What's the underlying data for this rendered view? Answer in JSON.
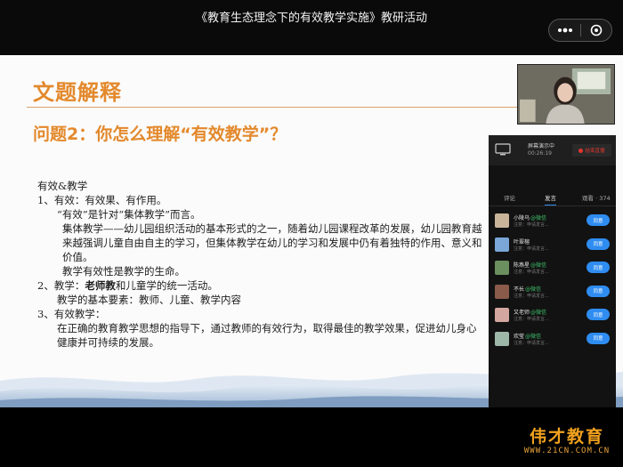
{
  "header": {
    "title": "《教育生态理念下的有效教学实施》教研活动",
    "more_icon": "more-dots-icon",
    "close_icon": "close-circle-icon"
  },
  "slide": {
    "title": "文题解释",
    "question": "问题2：你怎么理解“有效教学”？",
    "lines": [
      "有效&教学",
      "1、有效：有效果、有作用。",
      "“有效”是针对“集体教学”而言。",
      "集体教学——幼儿园组织活动的基本形式的之一，随着幼儿园课程改革的发展，幼儿园教育越来越强调儿童自由自主的学习，但集体教学在幼儿的学习和发展中仍有着独特的作用、意义和价值。",
      "教学有效性是教学的生命。",
      "2、教学：",
      "老师教",
      "和儿童学的统一活动。",
      "教学的基本要素：教师、儿童、教学内容",
      "3、有效教学：",
      "在正确的教育教学思想的指导下，通过教师的有效行为，取得最佳的教学效果，促进幼儿身心健康并可持续的发展。"
    ]
  },
  "live": {
    "status": "屏幕演示中",
    "timer": "00:26:19",
    "end_label": "结束直播",
    "tabs": {
      "comment": "评论",
      "speak": "发言",
      "viewers": "观看 · 374"
    },
    "join_label": "同意",
    "users": [
      {
        "name": "小陵乌",
        "tag": "@微信",
        "sub": "注意：申请发言...",
        "avatar_color": "#c9b49a"
      },
      {
        "name": "叶翠榕",
        "tag": "",
        "sub": "注意：申请发言...",
        "avatar_color": "#7aa6d8"
      },
      {
        "name": "陈燕星",
        "tag": "@微信",
        "sub": "注意：申请发言...",
        "avatar_color": "#6b8f5e"
      },
      {
        "name": "不长",
        "tag": "@微信",
        "sub": "注意：申请发言...",
        "avatar_color": "#8a5a4a"
      },
      {
        "name": "又老师",
        "tag": "@微信",
        "sub": "注意：申请发言...",
        "avatar_color": "#d3a6a0"
      },
      {
        "name": "欢莹",
        "tag": "@微信",
        "sub": "注意：申请发言...",
        "avatar_color": "#9db7a8"
      }
    ]
  },
  "watermark": {
    "brand": "伟才教育",
    "url": "WWW.21CN.COM.CN"
  }
}
